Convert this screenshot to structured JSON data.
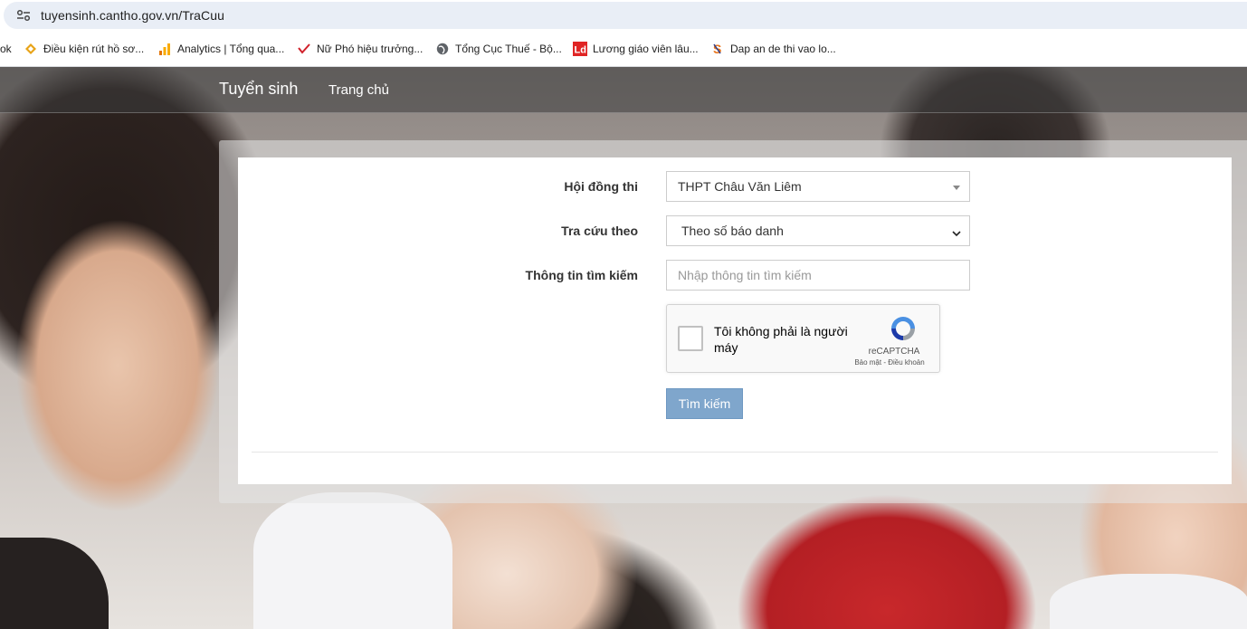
{
  "browser": {
    "url": "tuyensinh.cantho.gov.vn/TraCuu",
    "bookmarks": [
      {
        "label": "ok",
        "icon": "none"
      },
      {
        "label": "Điều kiện rút hồ sơ...",
        "icon": "diamond-icon"
      },
      {
        "label": "Analytics | Tổng qua...",
        "icon": "analytics-icon"
      },
      {
        "label": "Nữ Phó hiệu trưởng...",
        "icon": "checkmark-logo-icon"
      },
      {
        "label": "Tổng Cục Thuế - Bộ...",
        "icon": "globe-icon"
      },
      {
        "label": "Lương giáo viên lâu...",
        "icon": "ld-logo-icon"
      },
      {
        "label": "Dap an de thi vao lo...",
        "icon": "s-logo-icon"
      }
    ]
  },
  "navbar": {
    "brand": "Tuyển sinh",
    "home": "Trang chủ"
  },
  "form": {
    "council_label": "Hội đồng thi",
    "council_value": "THPT Châu Văn Liêm",
    "lookup_label": "Tra cứu theo",
    "lookup_value": "Theo số báo danh",
    "search_label": "Thông tin tìm kiếm",
    "search_placeholder": "Nhập thông tin tìm kiếm",
    "recaptcha_text": "Tôi không phải là người máy",
    "recaptcha_brand": "reCAPTCHA",
    "recaptcha_links": "Bảo mật - Điều khoản",
    "submit_label": "Tìm kiếm"
  },
  "colors": {
    "button": "#7fa6cc",
    "navbar": "#5a5a5a"
  }
}
